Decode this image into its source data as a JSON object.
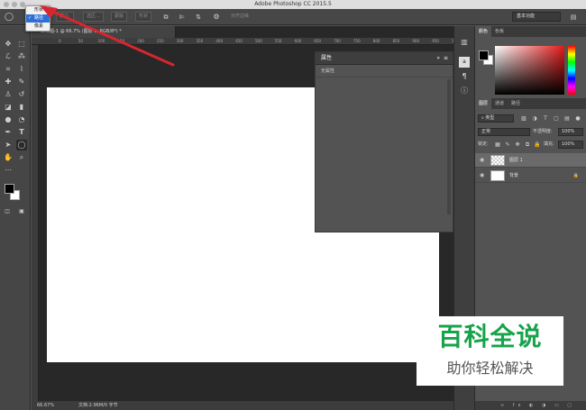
{
  "app": {
    "title": "Adobe Photoshop CC 2015.5"
  },
  "popup_menu": {
    "items": [
      {
        "label": "形状",
        "checked": false
      },
      {
        "label": "路径",
        "checked": true
      },
      {
        "label": "像素",
        "checked": false
      }
    ],
    "check_glyph": "✓"
  },
  "options_bar": {
    "buttons": [
      "建立:",
      "选区...",
      "蒙版",
      "形状"
    ],
    "align_edges": "对齐边缘",
    "workspace": "基本功能"
  },
  "document": {
    "tab_title": "未标题-1 @ 66.7% (图层 1, RGB/8*) *",
    "ruler_marks": [
      "0",
      "50",
      "100",
      "150",
      "200",
      "250",
      "300",
      "350",
      "400",
      "450",
      "500",
      "550",
      "600",
      "650",
      "700",
      "750",
      "800",
      "850",
      "900",
      "950",
      "1000"
    ],
    "zoom": "66.67%",
    "status": "文档:2.96M/0 字节"
  },
  "properties_panel": {
    "title": "属性",
    "no_properties": "无属性",
    "menu_glyph": "≡",
    "collapse_glyph": "»"
  },
  "color_panel": {
    "tabs": [
      "颜色",
      "色板"
    ],
    "foreground": "#000000",
    "background": "#ffffff"
  },
  "layers_panel": {
    "tabs": [
      "图层",
      "通道",
      "路径"
    ],
    "filter_kind": "类型",
    "blend_mode": "正常",
    "opacity_label": "不透明度:",
    "opacity_value": "100%",
    "lock_label": "锁定:",
    "fill_label": "填充:",
    "fill_value": "100%",
    "layers": [
      {
        "name": "图层 1",
        "selected": true,
        "transparent": true,
        "locked": false
      },
      {
        "name": "背景",
        "selected": false,
        "transparent": false,
        "locked": true
      }
    ],
    "footer_icons": "∞ fx ◐ ◑ ▭ ▢ 🗑"
  },
  "watermark": {
    "brand": "百科全说",
    "slogan": "助你轻松解决"
  },
  "colors": {
    "arrow": "#d8262e",
    "watermark_green": "#17a34a"
  },
  "icons": {
    "tools": [
      "move-icon",
      "marquee-icon",
      "lasso-icon",
      "magic-wand-icon",
      "crop-icon",
      "eyedropper-icon",
      "healing-brush-icon",
      "brush-icon",
      "clone-stamp-icon",
      "history-brush-icon",
      "eraser-icon",
      "gradient-icon",
      "blur-icon",
      "dodge-icon",
      "pen-icon",
      "type-icon",
      "path-selection-icon",
      "ellipse-icon",
      "hand-icon",
      "zoom-icon"
    ]
  }
}
